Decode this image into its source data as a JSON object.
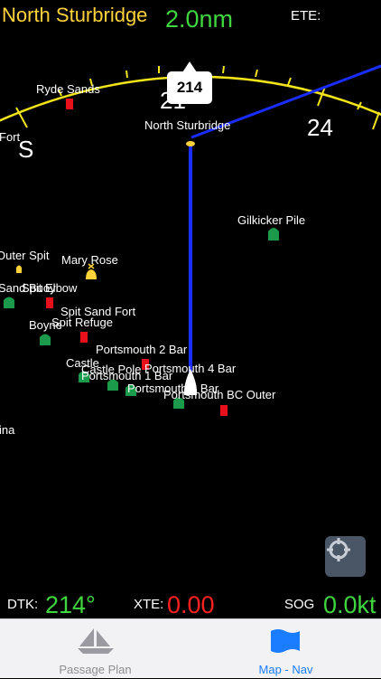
{
  "header": {
    "destination": "North Sturbridge",
    "distance": "2.0nm",
    "ete_label": "ETE:"
  },
  "compass": {
    "bearing_tag": "214",
    "ring_labels": [
      "S",
      "21",
      "24"
    ]
  },
  "map": {
    "waypoint_label": "North Sturbridge",
    "marks": [
      {
        "name": "Ryde Sands",
        "color": "red"
      },
      {
        "name": "Gilkicker Pile",
        "color": "green"
      },
      {
        "name": "Outer Spit",
        "color": "yellow"
      },
      {
        "name": "Mary Rose",
        "color": "yellow"
      },
      {
        "name": "Sand Buoy",
        "color": "green"
      },
      {
        "name": "Spit Elbow",
        "color": "red"
      },
      {
        "name": "Spit Sand Fort",
        "color": "none"
      },
      {
        "name": "Spit Refuge",
        "color": "red"
      },
      {
        "name": "Boyne",
        "color": "green"
      },
      {
        "name": "Portsmouth 2 Bar",
        "color": "red"
      },
      {
        "name": "Castle",
        "color": "green"
      },
      {
        "name": "Castle Pole",
        "color": "green"
      },
      {
        "name": "Portsmouth 4 Bar",
        "color": "none"
      },
      {
        "name": "Portsmouth 1 Bar",
        "color": "green"
      },
      {
        "name": "Portsmouth 3 Bar",
        "color": "none"
      },
      {
        "name": "Portsmouth BC Outer",
        "color": "green"
      },
      {
        "name": "Fort",
        "color": "none"
      },
      {
        "name": "ina",
        "color": "none"
      }
    ]
  },
  "status": {
    "dtk_label": "DTK:",
    "dtk_value": "214°",
    "xte_label": "XTE:",
    "xte_value": "0.00",
    "sog_label": "SOG",
    "sog_value": "0.0kt"
  },
  "tabs": [
    {
      "label": "Passage Plan",
      "icon": "sailboat-icon",
      "active": false
    },
    {
      "label": "Map - Nav",
      "icon": "flag-icon",
      "active": true
    }
  ],
  "colors": {
    "yellow": "#ffd23a",
    "green_text": "#3fd63f",
    "red_text": "#ff2020",
    "mark_red": "#e8101a",
    "mark_green": "#1a9a4a",
    "route_blue": "#1a2dff",
    "tab_active": "#1a7cff",
    "tab_inactive": "#8e8e93"
  }
}
